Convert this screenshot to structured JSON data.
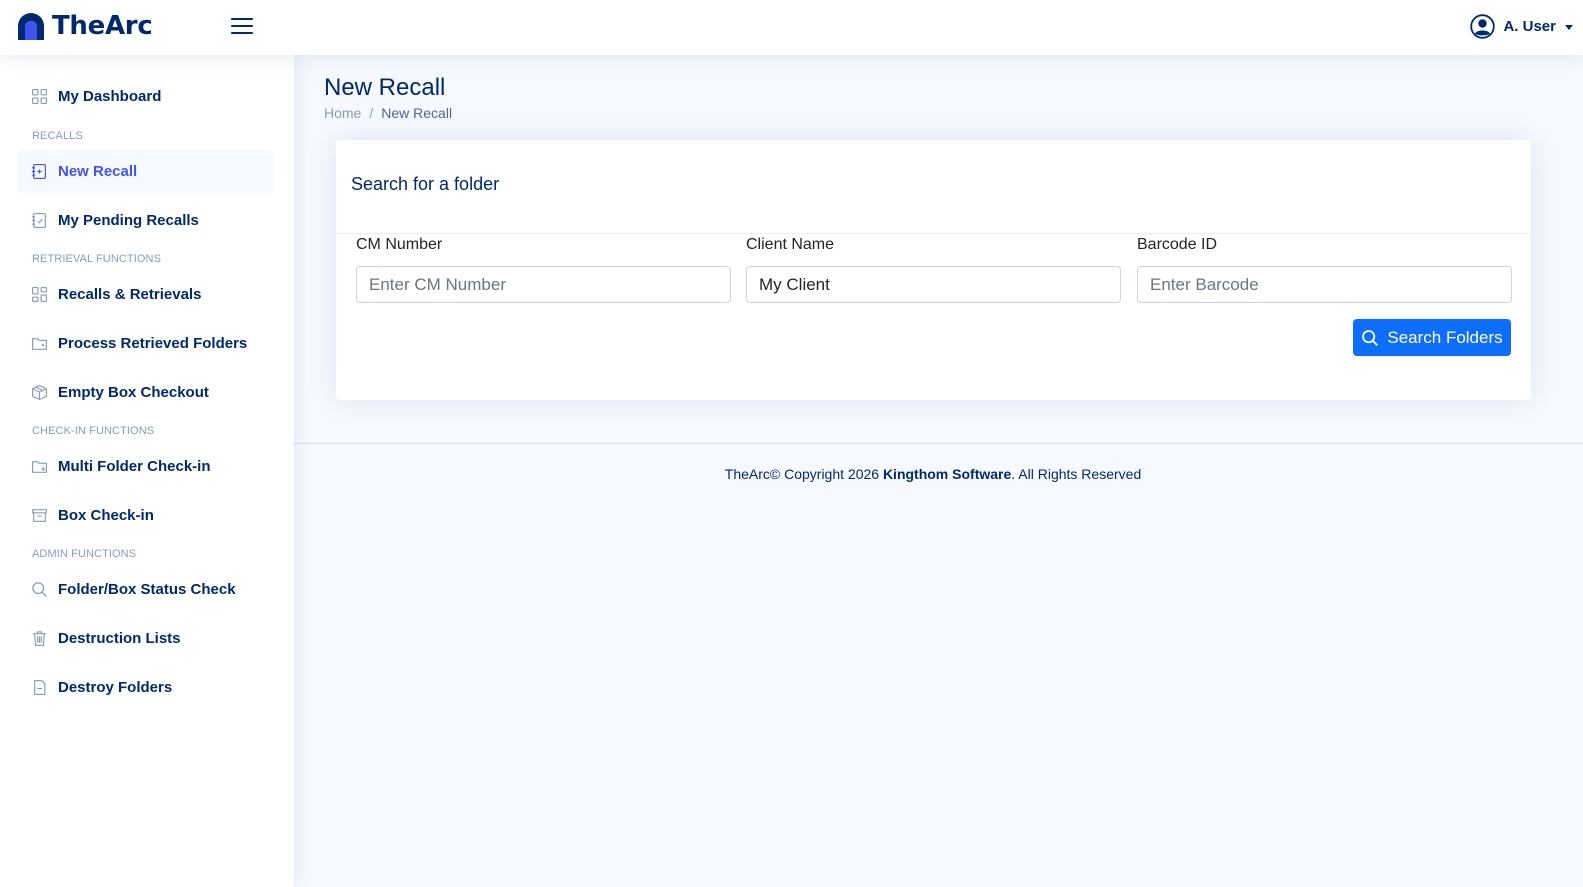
{
  "app": {
    "name": "TheArc",
    "user_name": "A. User"
  },
  "icons": {
    "menu": "hamburger-icon",
    "user": "user-circle-icon"
  },
  "sidebar": {
    "dashboard": "My Dashboard",
    "headings": [
      "RECALLS",
      "RETRIEVAL FUNCTIONS",
      "CHECK-IN FUNCTIONS",
      "ADMIN FUNCTIONS"
    ],
    "items": [
      {
        "label": "New Recall",
        "icon": "recall-icon",
        "active": true
      },
      {
        "label": "My Pending Recalls",
        "icon": "checklist-icon"
      },
      {
        "label": "Recalls & Retrievals",
        "icon": "grid-icon"
      },
      {
        "label": "Process Retrieved Folders",
        "icon": "folder-icon"
      },
      {
        "label": "Empty Box Checkout",
        "icon": "box-icon"
      },
      {
        "label": "Multi Folder Check-in",
        "icon": "folder-checkin-icon"
      },
      {
        "label": "Box Check-in",
        "icon": "archive-icon"
      },
      {
        "label": "Folder/Box Status Check",
        "icon": "search-icon"
      },
      {
        "label": "Destruction Lists",
        "icon": "trash-icon"
      },
      {
        "label": "Destroy Folders",
        "icon": "file-icon"
      }
    ]
  },
  "page": {
    "title": "New Recall",
    "breadcrumb": [
      "Home",
      "/",
      "New Recall"
    ]
  },
  "card": {
    "title": "Search for a folder",
    "fields": [
      {
        "label": "CM Number",
        "value": "",
        "placeholder": "Enter CM Number"
      },
      {
        "label": "Client Name",
        "value": "My Client",
        "placeholder": ""
      },
      {
        "label": "Barcode ID",
        "value": "",
        "placeholder": "Enter Barcode"
      }
    ],
    "search_button": "Search Folders"
  },
  "footer": {
    "prefix": "TheArc© Copyright 2026 ",
    "company": "Kingthom Software",
    "suffix": ". All Rights Reserved"
  },
  "colors": {
    "primary": "#0d6efd",
    "brand_navy": "#012970",
    "active_link": "#4154f1",
    "heading_gray": "#899bbd",
    "background": "#f6f9ff"
  }
}
